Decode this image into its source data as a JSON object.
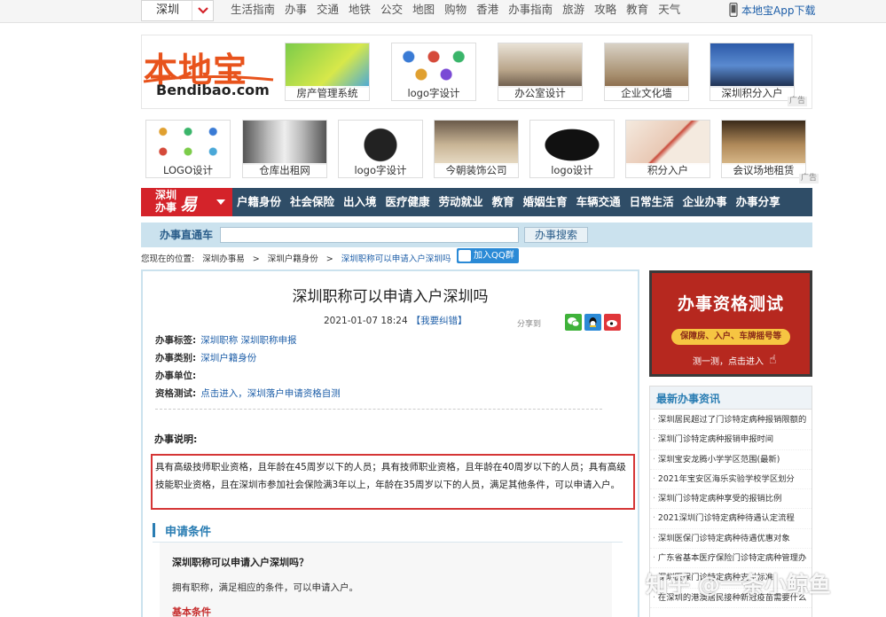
{
  "topbar": {
    "city": "深圳",
    "nav": [
      "生活指南",
      "办事",
      "交通",
      "地铁",
      "公交",
      "地图",
      "购物",
      "香港",
      "办事指南",
      "旅游",
      "攻略",
      "教育",
      "天气"
    ],
    "app_download": "本地宝App下载"
  },
  "logo": {
    "cn": "本地宝",
    "en": "Bendibao.com"
  },
  "ads_row1": [
    "房产管理系统",
    "logo字设计",
    "办公室设计",
    "企业文化墙",
    "深圳积分入户"
  ],
  "ads_row2": [
    "LOGO设计",
    "仓库出租网",
    "logo字设计",
    "今朝装饰公司",
    "logo设计",
    "积分入户",
    "会议场地租赁"
  ],
  "ad_tag": "广告",
  "mainnav": {
    "logo_line1": "深圳",
    "logo_line2": "办事",
    "logo_yi": "易",
    "items": [
      "户籍身份",
      "社会保险",
      "出入境",
      "医疗健康",
      "劳动就业",
      "教育",
      "婚姻生育",
      "车辆交通",
      "日常生活",
      "企业办事",
      "办事分享"
    ]
  },
  "search": {
    "label": "办事直通车",
    "value": "",
    "button": "办事搜索"
  },
  "breadcrumb": {
    "prefix": "您现在的位置:",
    "items": [
      "深圳办事易",
      "深圳户籍身份"
    ],
    "current": "深圳职称可以申请入户深圳吗",
    "qq_button": "加入QQ群"
  },
  "article": {
    "title": "深圳职称可以申请入户深圳吗",
    "date": "2021-01-07 18:24",
    "fix_link": "【我要纠错】",
    "share_label": "分享到",
    "meta": [
      {
        "label": "办事标签:",
        "value": "深圳职称 深圳职称申报"
      },
      {
        "label": "办事类别:",
        "value": "深圳户籍身份"
      },
      {
        "label": "办事单位:",
        "value": ""
      },
      {
        "label": "资格测试:",
        "value": "点击进入，深圳落户申请资格自测"
      }
    ],
    "section_title": "办事说明:",
    "description": "具有高级技师职业资格，且年龄在45周岁以下的人员；具有技师职业资格，且年龄在40周岁以下的人员；具有高级技能职业资格，且在深圳市参加社会保险满3年以上，年龄在35周岁以下的人员，满足其他条件，可以申请入户。",
    "apply_heading": "申请条件",
    "question": "深圳职称可以申请入户深圳吗？",
    "answer": "拥有职称，满足相应的条件，可以申请入户。",
    "basic_conditions": "基本条件"
  },
  "banner": {
    "title": "办事资格测试",
    "pill": "保障房、入户、车牌摇号等",
    "cta": "测一测，点击进入"
  },
  "news": {
    "heading": "最新办事资讯",
    "items": [
      "深圳居民超过了门诊特定病种报销限额的",
      "深圳门诊特定病种报销申报时间",
      "深圳宝安龙腾小学学区范围(最新)",
      "2021年宝安区海乐实验学校学区划分",
      "深圳门诊特定病种享受的报销比例",
      "2021深圳门诊特定病种待遇认定流程",
      "深圳医保门诊特定病种待遇优惠对象",
      "广东省基本医疗保险门诊特定病种管理办",
      "深圳医保门诊特定病种支付标准",
      "在深圳的港澳居民接种新冠疫苗需要什么"
    ]
  },
  "watermark": "知乎 @一条小鲸鱼",
  "colors": {
    "brand_orange": "#e8531c",
    "nav_blue": "#2f4d67",
    "nav_red": "#d4232a",
    "link_blue": "#1d5ea8",
    "highlight_red": "#d53636",
    "banner_red": "#b6281f"
  }
}
